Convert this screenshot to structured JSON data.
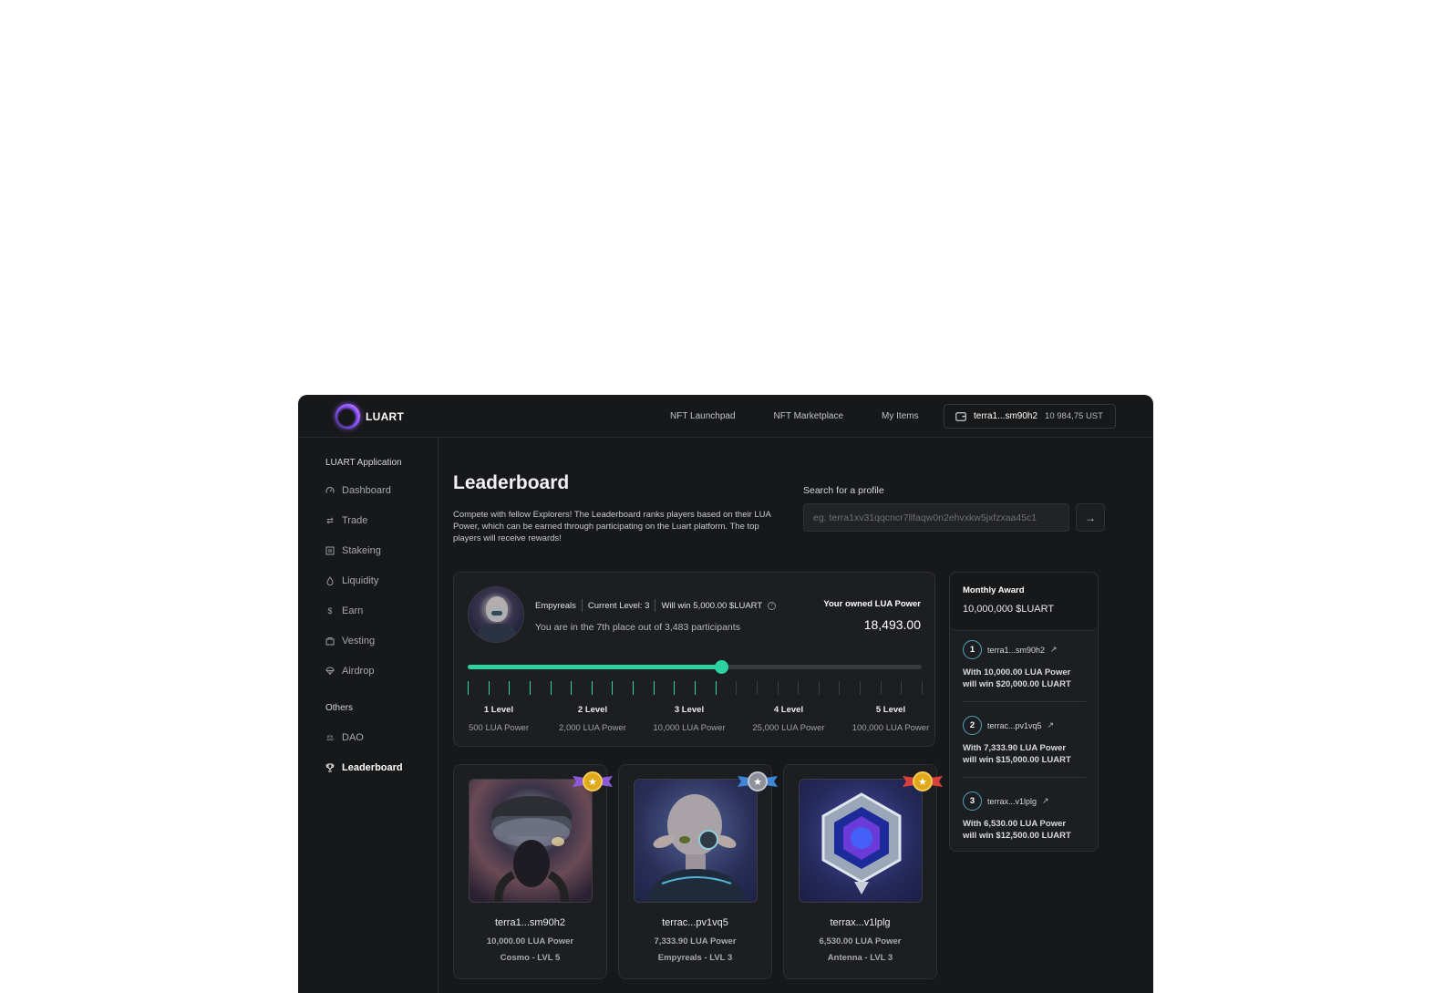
{
  "brand": {
    "name": "LUART"
  },
  "nav": [
    "NFT Launchpad",
    "NFT Marketplace",
    "My Items"
  ],
  "wallet": {
    "address": "terra1...sm90h2",
    "balance": "10 984,75 UST",
    "icon": "wallet-icon"
  },
  "sidebar": {
    "section_main": "LUART Application",
    "items": [
      {
        "label": "Dashboard",
        "icon": "gauge-icon"
      },
      {
        "label": "Trade",
        "icon": "swap-icon"
      },
      {
        "label": "Stakeing",
        "icon": "stake-icon"
      },
      {
        "label": "Liquidity",
        "icon": "drop-icon"
      },
      {
        "label": "Earn",
        "icon": "dollar-icon"
      },
      {
        "label": "Vesting",
        "icon": "vault-icon"
      },
      {
        "label": "Airdrop",
        "icon": "parachute-icon"
      }
    ],
    "section_others": "Others",
    "others": [
      {
        "label": "DAO",
        "icon": "scales-icon"
      },
      {
        "label": "Leaderboard",
        "icon": "trophy-icon",
        "active": true
      }
    ]
  },
  "page": {
    "title": "Leaderboard",
    "description": "Compete with fellow Explorers! The Leaderboard ranks players based on their LUA Power, which can be earned through participating on the Luart platform. The top players will receive rewards!",
    "search_label": "Search for a profile",
    "search_placeholder": "eg. terra1xv31qqcncr7llfaqw0n2ehvxkw5jxfzxaa45c1"
  },
  "progress": {
    "collection": "Empyreals",
    "current_level": "Current Level: 3",
    "will_win": "Will win 5,000.00 $LUART",
    "place_text": "You are in the 7th place out of 3,483 participants",
    "owned_label": "Your owned LUA Power",
    "owned_value": "18,493.00",
    "fill_fraction": 0.558,
    "filled_ticks": 13,
    "total_ticks": 23,
    "accent": "#2ad3a0",
    "levels": [
      {
        "name": "1 Level",
        "power": "500 LUA Power"
      },
      {
        "name": "2 Level",
        "power": "2,000 LUA Power"
      },
      {
        "name": "3 Level",
        "power": "10,000 LUA Power"
      },
      {
        "name": "4 Level",
        "power": "25,000 LUA Power"
      },
      {
        "name": "5 Level",
        "power": "100,000 LUA Power"
      }
    ]
  },
  "award": {
    "title": "Monthly Award",
    "amount": "10,000,000 $LUART",
    "ranks": [
      {
        "rank": "1",
        "address": "terra1...sm90h2",
        "line1": "With 10,000.00 LUA Power",
        "line2": "will win $20,000.00 LUART"
      },
      {
        "rank": "2",
        "address": "terrac...pv1vq5",
        "line1": "With 7,333.90 LUA Power",
        "line2": "will win $15,000.00 LUART"
      },
      {
        "rank": "3",
        "address": "terrax...v1lplg",
        "line1": "With 6,530.00 LUA Power",
        "line2": "will win $12,500.00 LUART"
      }
    ]
  },
  "top3": [
    {
      "address": "terra1...sm90h2",
      "power": "10,000.00 LUA Power",
      "tag": "Cosmo - LVL 5",
      "medal": "gold-medal-icon",
      "medal_color": "#e0a91c",
      "wing_color": "#8c5ad6"
    },
    {
      "address": "terrac...pv1vq5",
      "power": "7,333.90 LUA Power",
      "tag": "Empyreals - LVL 3",
      "medal": "silver-medal-icon",
      "medal_color": "#8d9098",
      "wing_color": "#3d86d8"
    },
    {
      "address": "terrax...v1lplg",
      "power": "6,530.00 LUA Power",
      "tag": "Antenna - LVL 3",
      "medal": "bronze-medal-icon",
      "medal_color": "#e0a91c",
      "wing_color": "#d8403d"
    }
  ]
}
